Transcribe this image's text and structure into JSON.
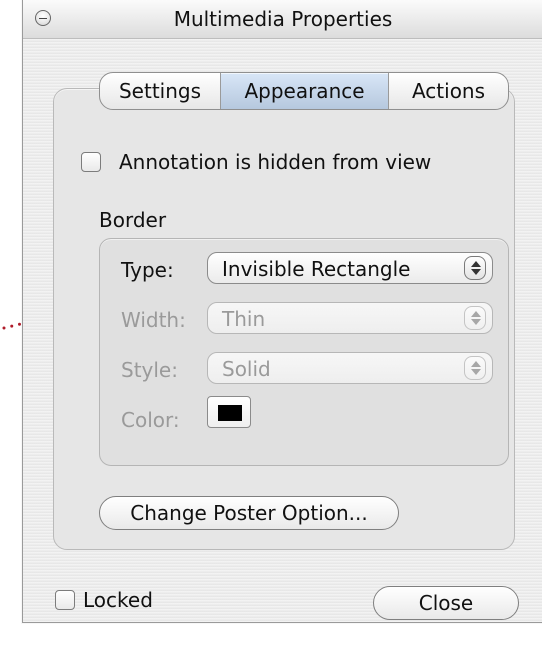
{
  "window": {
    "title": "Multimedia Properties"
  },
  "tabs": [
    {
      "label": "Settings"
    },
    {
      "label": "Appearance"
    },
    {
      "label": "Actions"
    }
  ],
  "appearance": {
    "hidden_checkbox_label": "Annotation is hidden from view",
    "border_group_title": "Border",
    "type_label": "Type:",
    "type_value": "Invisible Rectangle",
    "width_label": "Width:",
    "width_value": "Thin",
    "style_label": "Style:",
    "style_value": "Solid",
    "color_label": "Color:",
    "color_hex": "#000000",
    "change_poster_button": "Change Poster Option..."
  },
  "footer": {
    "locked_label": "Locked",
    "close_button": "Close"
  },
  "icons": {
    "close_dot": "window-close-dot-icon",
    "popup_arrows": "popup-arrows-icon"
  }
}
